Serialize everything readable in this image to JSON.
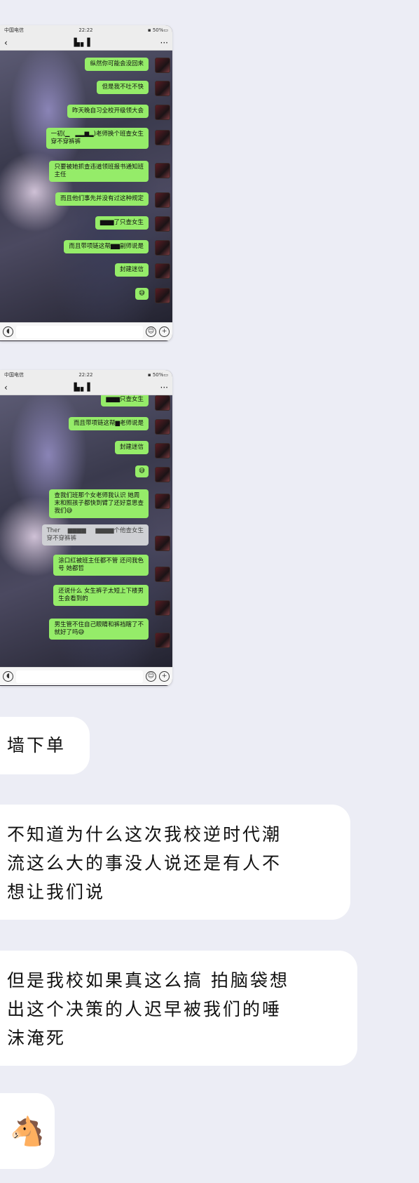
{
  "screenshot1": {
    "status_left": "中国电信 ",
    "status_time": "22:22",
    "status_right": "▪ 50%▭",
    "back_icon": "chevron-left-icon",
    "title": "▙▖▌",
    "more_label": "···",
    "messages": [
      "纵然你可能会没回来",
      "但是我不吐不快",
      "昨天晚自习全校开级领大会",
      "一初(▁   ▂▂▆▂)老师换个班查女生\n穿不穿裤裤",
      "只要被她抓查违道领班报书通知班\n主任",
      "而且他们事先并没有过这种规定",
      "▆▆▆了只查女生",
      "而且带项链这帮▆▆副师说是",
      "封建迷信",
      "😅"
    ]
  },
  "screenshot2": {
    "status_left": "中国电信 ",
    "status_time": "22:22",
    "status_right": "▪ 50%▭",
    "title": "▙▖▌",
    "more_label": "···",
    "messages": [
      "▆▆▆只查女生",
      "而且带项链这帮▆老师说是",
      "封建迷信",
      "😅",
      "查我们班那个女老师我认识 她周\n末和照孩子都快到臂了还好意思查\n我们😅",
      "Ther    ▆▆▆▆     ▆▆▆▆个他查女生\n穿不穿裤裤",
      "涂口红被班主任都不管 还问我色\n号 她都哲",
      "还说什么 女生裤子太短上下楼男\n生会看到的",
      "男生管不住自己眼睛和裤裆瞎了不\n就好了吗😅"
    ]
  },
  "posts": [
    "墙下单",
    "不知道为什么这次我校逆时代潮\n流这么大的事没人说还是有人不\n想让我们说",
    "但是我校如果真这么搞 拍脑袋想\n出这个决策的人迟早被我们的唾\n沫淹死",
    "🐴"
  ],
  "icons": {
    "voice": "voice-icon",
    "emoji": "emoji-icon",
    "plus": "plus-icon"
  },
  "colors": {
    "bubble_green": "#95ec69",
    "page_background": "#ecedf5"
  }
}
